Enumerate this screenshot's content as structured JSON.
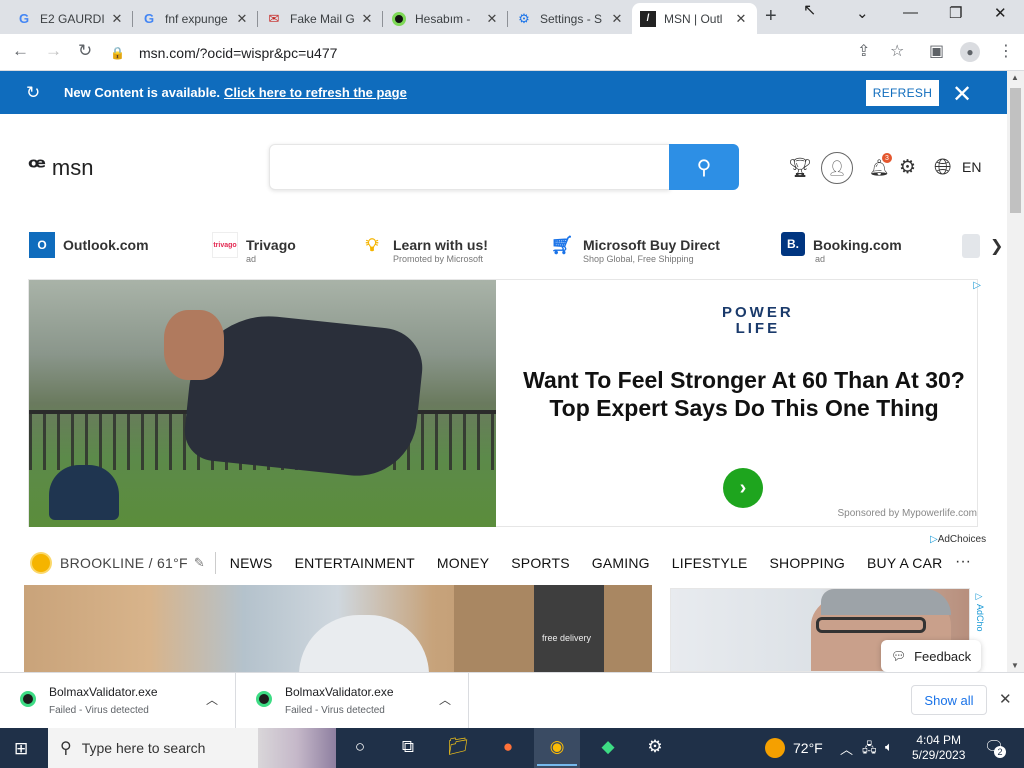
{
  "browser": {
    "tabs": [
      {
        "title": "E2 GAURDI",
        "icon": "google-icon"
      },
      {
        "title": "fnf expunge",
        "icon": "google-icon"
      },
      {
        "title": "Fake Mail G",
        "icon": "mail-icon"
      },
      {
        "title": "Hesabım -",
        "icon": "site-icon"
      },
      {
        "title": "Settings - S",
        "icon": "settings-icon"
      },
      {
        "title": "MSN | Outl",
        "icon": "msn-icon",
        "active": true
      }
    ],
    "url": "msn.com/?ocid=wispr&pc=u477"
  },
  "notification": {
    "message": "New Content is available.",
    "link": "Click here to refresh the page",
    "refresh_label": "REFRESH"
  },
  "msn": {
    "logo_text": "msn",
    "search_placeholder": "",
    "notification_count": "3",
    "language": "EN"
  },
  "quick_links": [
    {
      "label": "Outlook.com",
      "sub": "",
      "color": "#0f6cbd"
    },
    {
      "label": "Trivago",
      "sub": "ad",
      "color": "#e32851"
    },
    {
      "label": "Learn with us!",
      "sub": "Promoted by Microsoft",
      "color": "#f5b400"
    },
    {
      "label": "Microsoft Buy Direct",
      "sub": "Shop Global, Free Shipping",
      "color": "#1a73e8"
    },
    {
      "label": "Booking.com",
      "sub": "ad",
      "color": "#003580"
    }
  ],
  "ad": {
    "brand_line1": "POWER",
    "brand_line2": "LIFE",
    "headline": "Want To Feel Stronger At 60 Than At 30? Top Expert Says Do This One Thing",
    "sponsored": "Sponsored by Mypowerlife.com",
    "adchoices": "AdChoices"
  },
  "navbar": {
    "location": "BROOKLINE / 61°F",
    "items": [
      "NEWS",
      "ENTERTAINMENT",
      "MONEY",
      "SPORTS",
      "GAMING",
      "LIFESTYLE",
      "SHOPPING",
      "BUY A CAR"
    ]
  },
  "card1": {
    "box_text": "free delivery"
  },
  "feedback_label": "Feedback",
  "downloads": [
    {
      "name": "BolmaxValidator.exe",
      "status": "Failed - Virus detected"
    },
    {
      "name": "BolmaxValidator.exe",
      "status": "Failed - Virus detected"
    }
  ],
  "show_all_label": "Show all",
  "taskbar": {
    "search_placeholder": "Type here to search",
    "weather": "72°F",
    "time": "4:04 PM",
    "date": "5/29/2023",
    "notification_count": "2"
  }
}
